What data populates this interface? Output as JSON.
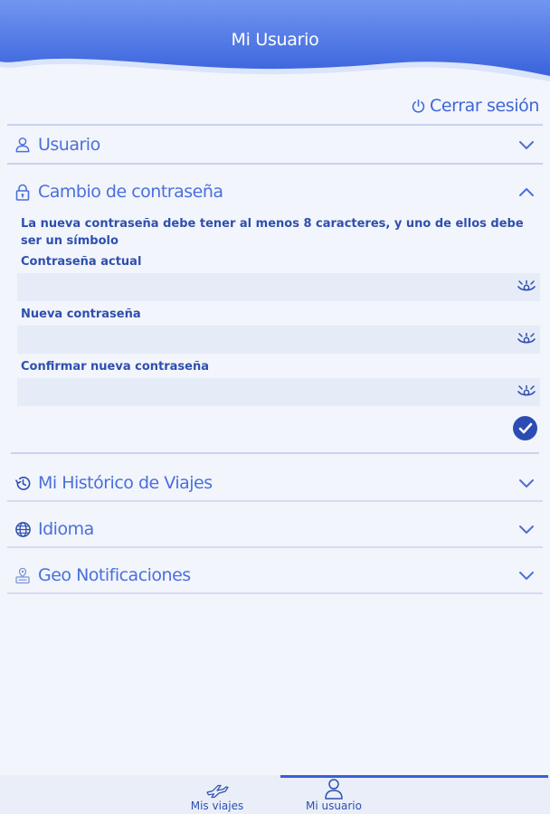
{
  "header": {
    "title": "Mi Usuario"
  },
  "logout": {
    "label": "Cerrar sesión",
    "icon": "power-icon"
  },
  "sections": {
    "usuario": {
      "label": "Usuario",
      "icon": "user-icon",
      "expanded": false
    },
    "password": {
      "label": "Cambio de contraseña",
      "icon": "lock-icon",
      "expanded": true,
      "info": "La nueva contraseña debe tener al menos 8 caracteres, y uno de ellos debe ser un símbolo",
      "fields": {
        "current": {
          "label": "Contraseña actual",
          "value": ""
        },
        "new": {
          "label": "Nueva contraseña",
          "value": ""
        },
        "confirm": {
          "label": "Confirmar nueva contraseña",
          "value": ""
        }
      }
    },
    "historico": {
      "label": "Mi Histórico de Viajes",
      "icon": "history-icon",
      "expanded": false
    },
    "idioma": {
      "label": "Idioma",
      "icon": "globe-icon",
      "expanded": false
    },
    "geo": {
      "label": "Geo Notificaciones",
      "icon": "geo-notification-icon",
      "expanded": false
    }
  },
  "bottom_nav": {
    "items": [
      {
        "label": "Mis viajes",
        "icon": "plane-icon",
        "active": false
      },
      {
        "label": "Mi usuario",
        "icon": "user-icon",
        "active": true
      }
    ]
  },
  "colors": {
    "primary": "#3a5fd6",
    "dark": "#2b4db3",
    "background": "#f2f5fb",
    "field": "#e6ebf8"
  }
}
